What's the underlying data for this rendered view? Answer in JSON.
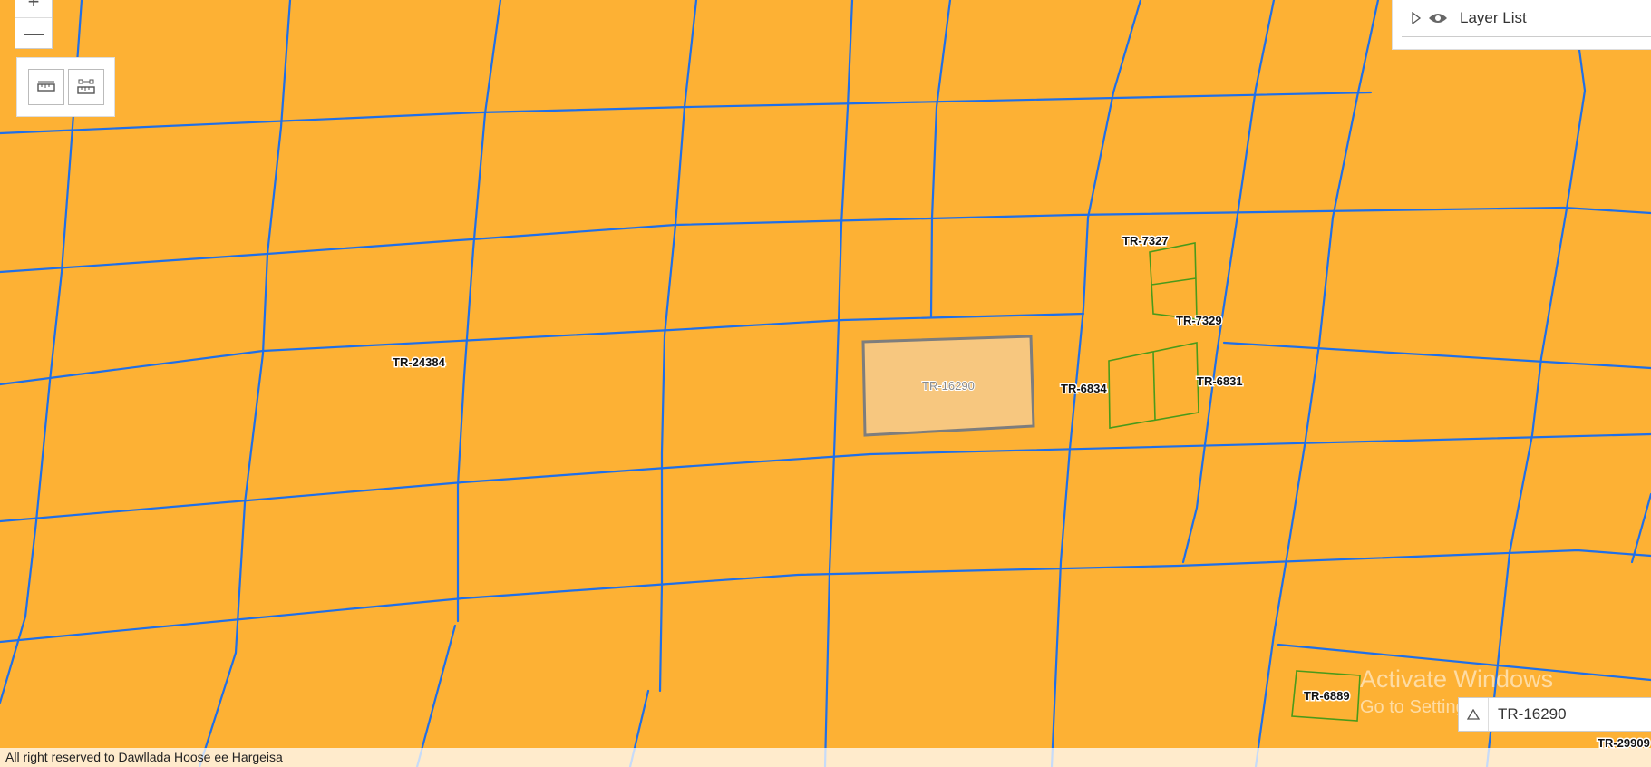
{
  "map": {
    "parcel_labels": [
      "TR-24384",
      "TR-16290",
      "TR-7327",
      "TR-7329",
      "TR-6834",
      "TR-6831",
      "TR-6889",
      "TR-29909"
    ],
    "selected_parcel": "TR-16290",
    "colors": {
      "background": "#fdb134",
      "road": "#1f6fe8",
      "selected_fill": "#f7c77f",
      "selected_outline": "#7d7d7d",
      "parcel_outline": "#4a9a1a"
    }
  },
  "zoom": {
    "zoom_in_icon": "plus-icon",
    "zoom_out_icon": "minus-icon",
    "zoom_out_symbol": "—"
  },
  "tools": {
    "measure_distance_icon": "ruler-icon",
    "measure_area_icon": "area-ruler-icon"
  },
  "layer_list": {
    "title": "Layer List",
    "expand_icon": "triangle-right-icon",
    "visibility_icon": "eye-icon"
  },
  "search": {
    "value": "TR-16290",
    "toggle_icon": "triangle-up-icon"
  },
  "attribution": "All right reserved to Dawllada Hoose ee Hargeisa",
  "watermark": {
    "line1": "Activate Windows",
    "line2": "Go to Settings to activate Windows."
  }
}
